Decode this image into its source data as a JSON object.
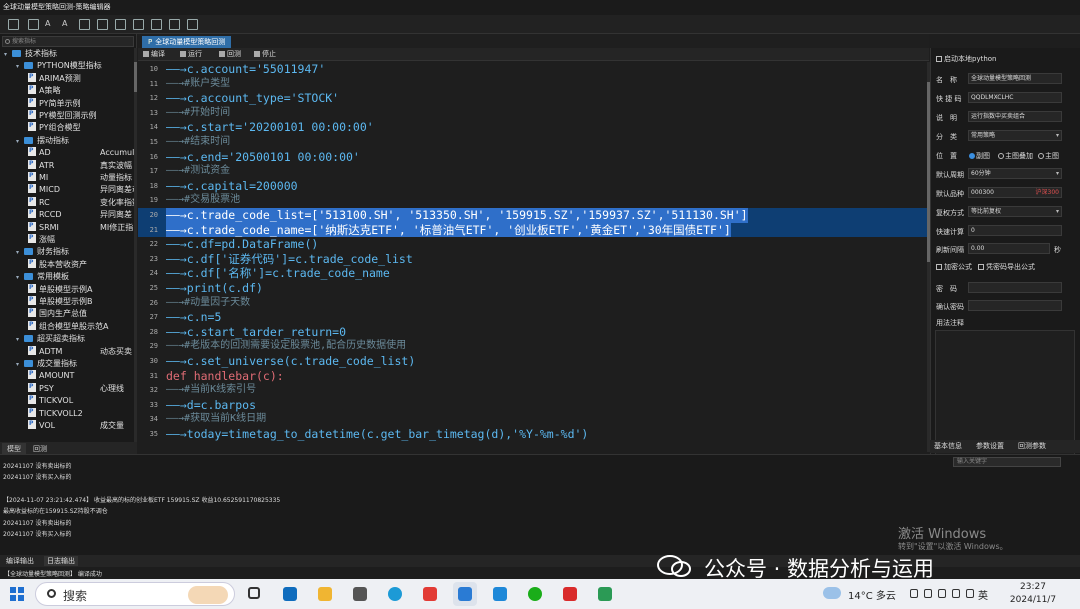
{
  "window": {
    "title": "全球动量模型策略回测-策略编辑器"
  },
  "left_panel": {
    "search_placeholder": "搜索指标",
    "tree": [
      {
        "level": 0,
        "label": "技术指标",
        "right": "",
        "kind": "folder"
      },
      {
        "level": 1,
        "label": "PYTHON模型指标",
        "right": "",
        "kind": "folder"
      },
      {
        "level": 2,
        "label": "ARIMA预测",
        "right": "",
        "kind": "file"
      },
      {
        "level": 2,
        "label": "A策略",
        "right": "",
        "kind": "file"
      },
      {
        "level": 2,
        "label": "PY简单示例",
        "right": "",
        "kind": "file"
      },
      {
        "level": 2,
        "label": "PY模型回测示例",
        "right": "",
        "kind": "file"
      },
      {
        "level": 2,
        "label": "PY组合模型",
        "right": "",
        "kind": "file"
      },
      {
        "level": 1,
        "label": "摆动指标",
        "right": "",
        "kind": "folder"
      },
      {
        "level": 2,
        "label": "AD",
        "right": "Accumulat",
        "kind": "file"
      },
      {
        "level": 2,
        "label": "ATR",
        "right": "真实波幅",
        "kind": "file"
      },
      {
        "level": 2,
        "label": "MI",
        "right": "动量指标",
        "kind": "file"
      },
      {
        "level": 2,
        "label": "MICD",
        "right": "异同离差动",
        "kind": "file"
      },
      {
        "level": 2,
        "label": "RC",
        "right": "变化率指数",
        "kind": "file"
      },
      {
        "level": 2,
        "label": "RCCD",
        "right": "异同离差",
        "kind": "file"
      },
      {
        "level": 2,
        "label": "SRMI",
        "right": "MI修正指",
        "kind": "file"
      },
      {
        "level": 2,
        "label": "涨幅",
        "right": "",
        "kind": "file"
      },
      {
        "level": 1,
        "label": "财务指标",
        "right": "",
        "kind": "folder"
      },
      {
        "level": 2,
        "label": "股本营收资产",
        "right": "",
        "kind": "file"
      },
      {
        "level": 1,
        "label": "常用模板",
        "right": "",
        "kind": "folder"
      },
      {
        "level": 2,
        "label": "单股模型示例A",
        "right": "",
        "kind": "file"
      },
      {
        "level": 2,
        "label": "单股模型示例B",
        "right": "",
        "kind": "file"
      },
      {
        "level": 2,
        "label": "国内生产总值",
        "right": "",
        "kind": "file"
      },
      {
        "level": 2,
        "label": "组合模型单股示范A",
        "right": "",
        "kind": "file"
      },
      {
        "level": 1,
        "label": "超买超卖指标",
        "right": "",
        "kind": "folder"
      },
      {
        "level": 2,
        "label": "ADTM",
        "right": "动态买卖",
        "kind": "file"
      },
      {
        "level": 1,
        "label": "成交量指标",
        "right": "",
        "kind": "folder"
      },
      {
        "level": 2,
        "label": "AMOUNT",
        "right": "",
        "kind": "file"
      },
      {
        "level": 2,
        "label": "PSY",
        "right": "心理线",
        "kind": "file"
      },
      {
        "level": 2,
        "label": "TICKVOL",
        "right": "",
        "kind": "file"
      },
      {
        "level": 2,
        "label": "TICKVOLL2",
        "right": "",
        "kind": "file"
      },
      {
        "level": 2,
        "label": "VOL",
        "right": "成交量",
        "kind": "file"
      }
    ],
    "tabs": [
      "模型",
      "回测"
    ]
  },
  "editor": {
    "tab_title": "全球动量模型策略回测",
    "toolbar": [
      "编译",
      "运行",
      "回测",
      "停止"
    ],
    "lines": [
      {
        "n": "10",
        "text": "——→c.account='55011947'",
        "style": "code"
      },
      {
        "n": "11",
        "text": "——→#账户类型",
        "style": "comment"
      },
      {
        "n": "12",
        "text": "——→c.account_type='STOCK'",
        "style": "code"
      },
      {
        "n": "13",
        "text": "——→#开始时间",
        "style": "comment"
      },
      {
        "n": "14",
        "text": "——→c.start='20200101 00:00:00'",
        "style": "code"
      },
      {
        "n": "15",
        "text": "——→#结束时间",
        "style": "comment"
      },
      {
        "n": "16",
        "text": "——→c.end='20500101 00:00:00'",
        "style": "code"
      },
      {
        "n": "17",
        "text": "——→#测试资金",
        "style": "comment"
      },
      {
        "n": "18",
        "text": "——→c.capital=200000",
        "style": "code"
      },
      {
        "n": "19",
        "text": "——→#交易股票池",
        "style": "comment"
      },
      {
        "n": "20",
        "text": "——→c.trade_code_list=['513100.SH', '513350.SH', '159915.SZ','159937.SZ','511130.SH']",
        "style": "selected"
      },
      {
        "n": "21",
        "text": "——→c.trade_code_name=['纳斯达克ETF', '标普油气ETF', '创业板ETF','黄金ET','30年国债ETF']",
        "style": "selected"
      },
      {
        "n": "22",
        "text": "——→c.df=pd.DataFrame()",
        "style": "code"
      },
      {
        "n": "23",
        "text": "——→c.df['证券代码']=c.trade_code_list",
        "style": "code"
      },
      {
        "n": "24",
        "text": "——→c.df['名称']=c.trade_code_name",
        "style": "code"
      },
      {
        "n": "25",
        "text": "——→print(c.df)",
        "style": "code"
      },
      {
        "n": "26",
        "text": "——→#动量因子天数",
        "style": "comment"
      },
      {
        "n": "27",
        "text": "——→c.n=5",
        "style": "code"
      },
      {
        "n": "28",
        "text": "——→c.start_tarder_return=0",
        "style": "code"
      },
      {
        "n": "29",
        "text": "——→#老版本的回测需要设定股票池,配合历史数据使用",
        "style": "comment"
      },
      {
        "n": "30",
        "text": "——→c.set_universe(c.trade_code_list)",
        "style": "code"
      },
      {
        "n": "31",
        "text": "def handlebar(c):",
        "style": "def"
      },
      {
        "n": "32",
        "text": "——→#当前K线索引号",
        "style": "comment"
      },
      {
        "n": "33",
        "text": "——→d=c.barpos",
        "style": "code"
      },
      {
        "n": "34",
        "text": "——→#获取当前K线日期",
        "style": "comment"
      },
      {
        "n": "35",
        "text": "——→today=timetag_to_datetime(c.get_bar_timetag(d),'%Y-%m-%d')",
        "style": "code"
      }
    ]
  },
  "right_panel": {
    "enable_python": "启动本地python",
    "name_label": "名　称",
    "name_value": "全球动量模型策略回测",
    "shortcode_label": "快 捷 码",
    "shortcode_value": "QQDLMXCLHC",
    "desc_label": "说　明",
    "desc_value": "运行指数中买卖组合",
    "category_label": "分　类",
    "category_value": "常用策略",
    "position_label": "位　置",
    "position_options": [
      "副图",
      "主图叠加",
      "主图"
    ],
    "period_label": "默认周期",
    "period_value": "60分钟",
    "symbol_label": "默认品种",
    "symbol_value": "000300",
    "symbol_tag": "沪深300",
    "adjust_label": "复权方式",
    "adjust_value": "等比前复权",
    "fast_calc_label": "快速计算",
    "fast_calc_value": "0",
    "refresh_label": "刷新间隔",
    "refresh_value": "0.00",
    "refresh_unit": "秒",
    "encrypt_label": "加密公式",
    "export_label": "凭密码导出公式",
    "password_label": "密　码",
    "confirm_label": "确认密码",
    "notes_label": "用法注释",
    "tabs": [
      "基本信息",
      "参数设置",
      "回测参数"
    ]
  },
  "output": {
    "search_placeholder": "输入关键字",
    "lines": [
      "20241107 没有卖出标的",
      "20241107 没有买入标的",
      "",
      "【2024-11-07 23:21:42.474】  收益最高的标的创业板ETF 159915.SZ 收益10.652591170825335",
      "最高收益标的在159915.SZ持股不调仓",
      "20241107 没有卖出标的",
      "20241107 没有买入标的"
    ],
    "tabs": [
      "编译输出",
      "日志输出"
    ],
    "status": "【全球动量模型策略回测】 编译成功",
    "activation_title": "激活 Windows",
    "activation_sub": "转到\"设置\"以激活 Windows。"
  },
  "overlay": {
    "wechat_text": "公众号 · 数据分析与运用"
  },
  "taskbar": {
    "search": "搜索",
    "weather": "14°C 多云",
    "lang": "英",
    "time": "23:27",
    "date": "2024/11/7"
  }
}
